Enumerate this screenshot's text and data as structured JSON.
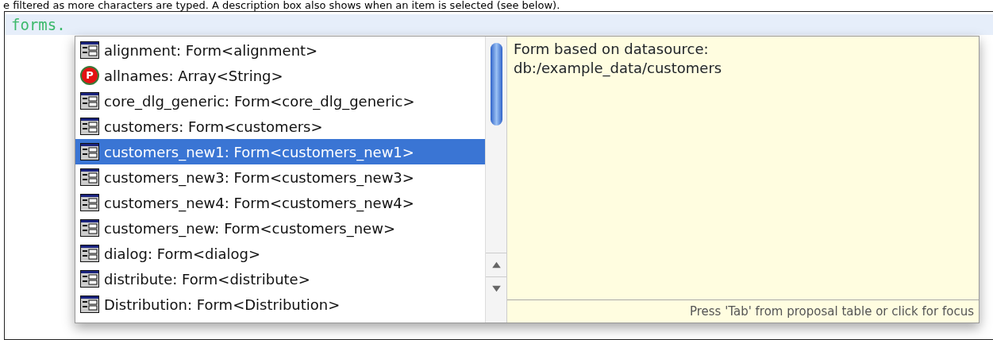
{
  "caption": "e filtered as more characters are typed. A description box also shows when an item is selected (see below).",
  "editor": {
    "code": "forms."
  },
  "proposals": [
    {
      "kind": "form",
      "label": "alignment: Form<alignment>",
      "selected": false
    },
    {
      "kind": "property",
      "icon_text": "P",
      "label": "allnames: Array<String>",
      "selected": false
    },
    {
      "kind": "form",
      "label": "core_dlg_generic: Form<core_dlg_generic>",
      "selected": false
    },
    {
      "kind": "form",
      "label": "customers: Form<customers>",
      "selected": false
    },
    {
      "kind": "form",
      "label": "customers_new1: Form<customers_new1>",
      "selected": true
    },
    {
      "kind": "form",
      "label": "customers_new3: Form<customers_new3>",
      "selected": false
    },
    {
      "kind": "form",
      "label": "customers_new4: Form<customers_new4>",
      "selected": false
    },
    {
      "kind": "form",
      "label": "customers_new: Form<customers_new>",
      "selected": false
    },
    {
      "kind": "form",
      "label": "dialog: Form<dialog>",
      "selected": false
    },
    {
      "kind": "form",
      "label": "distribute: Form<distribute>",
      "selected": false
    },
    {
      "kind": "form",
      "label": "Distribution: Form<Distribution>",
      "selected": false
    }
  ],
  "description": {
    "lines": [
      "Form based on datasource:",
      "db:/example_data/customers"
    ],
    "footer": "Press 'Tab' from proposal table or click for focus"
  }
}
